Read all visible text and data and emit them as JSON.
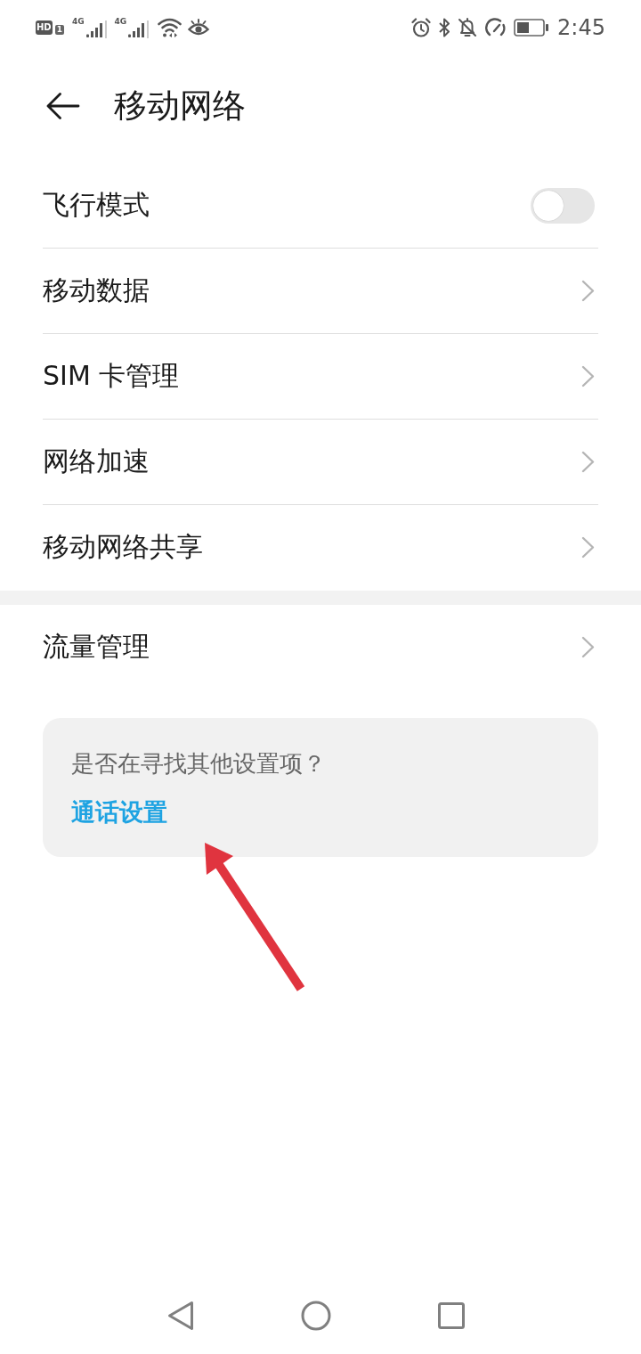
{
  "status_bar": {
    "hd_label": "HD",
    "sim_label": "1",
    "sims": [
      {
        "network": "4G"
      },
      {
        "network": "4G"
      }
    ],
    "time": "2:45"
  },
  "header": {
    "title": "移动网络"
  },
  "sections": [
    {
      "items": [
        {
          "kind": "toggle",
          "label": "飞行模式",
          "on": false
        },
        {
          "kind": "link",
          "label": "移动数据"
        },
        {
          "kind": "link",
          "label": "SIM 卡管理"
        },
        {
          "kind": "link",
          "label": "网络加速"
        },
        {
          "kind": "link",
          "label": "移动网络共享"
        }
      ]
    },
    {
      "items": [
        {
          "kind": "link",
          "label": "流量管理"
        }
      ]
    }
  ],
  "suggestion_card": {
    "question": "是否在寻找其他设置项？",
    "link": "通话设置"
  }
}
